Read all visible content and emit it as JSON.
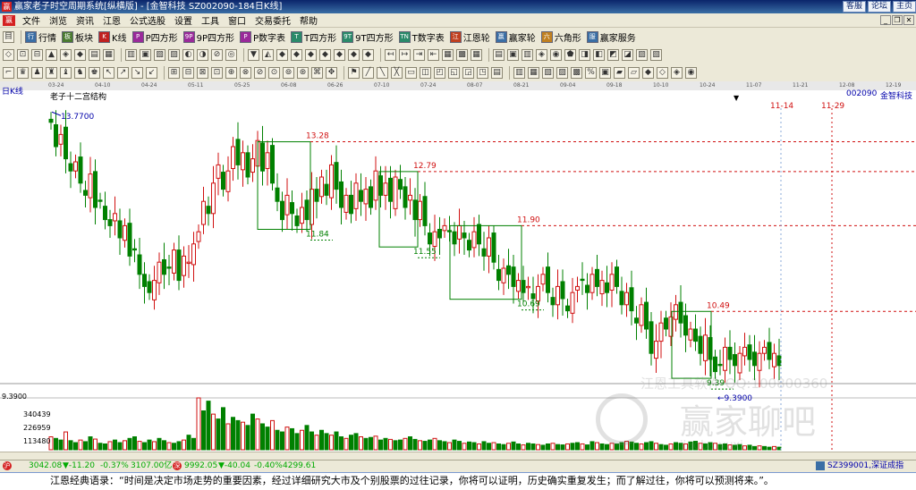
{
  "app": {
    "title": "赢家老子时空周期系统[纵横版] - [金智科技  SZ002090-184日K线]",
    "logo": "赢",
    "title_links": [
      "客服",
      "论坛",
      "主页"
    ]
  },
  "menu": {
    "logo": "赢",
    "items": [
      "文件",
      "浏览",
      "资讯",
      "江恩",
      "公式选股",
      "设置",
      "工具",
      "窗口",
      "交易委托",
      "帮助"
    ]
  },
  "toolbar1": [
    {
      "icon": "行",
      "label": "行情",
      "color": "#3a6ea5"
    },
    {
      "icon": "板",
      "label": "板块",
      "color": "#4a7a30"
    },
    {
      "icon": "K",
      "label": "K线",
      "color": "#c02020"
    },
    {
      "icon": "P",
      "label": "P四方形",
      "color": "#9a2a9a"
    },
    {
      "icon": "9P",
      "label": "9P四方形",
      "color": "#9a2a9a"
    },
    {
      "icon": "P",
      "label": "P数字表",
      "color": "#9a2a9a"
    },
    {
      "icon": "T",
      "label": "T四方形",
      "color": "#2a8a6a"
    },
    {
      "icon": "9T",
      "label": "9T四方形",
      "color": "#2a8a6a"
    },
    {
      "icon": "TN",
      "label": "T数字表",
      "color": "#2a8a6a"
    },
    {
      "icon": "江",
      "label": "江恩轮",
      "color": "#c04020"
    },
    {
      "icon": "赢",
      "label": "赢家轮",
      "color": "#3a6ea5"
    },
    {
      "icon": "六",
      "label": "六角形",
      "color": "#c08020"
    },
    {
      "icon": "服",
      "label": "赢家服务",
      "color": "#3a6ea5"
    }
  ],
  "toolbar2_icons": [
    "◇",
    "⊡",
    "⊟",
    "▲",
    "◈",
    "◆",
    "▤",
    "▦",
    "▥",
    "▣",
    "▧",
    "▨",
    "◐",
    "◑",
    "⊘",
    "◎",
    "▼",
    "◭",
    "◆",
    "◆",
    "◆",
    "◆",
    "◆",
    "◆",
    "◆",
    "↤",
    "↦",
    "⇥",
    "⇤",
    "▦",
    "▩",
    "▦",
    "▤",
    "▣",
    "▥",
    "◈",
    "◉",
    "⬟",
    "◨",
    "◧",
    "◩",
    "◪",
    "▨",
    "▧"
  ],
  "toolbar3_icons": [
    "⌐",
    "♛",
    "♟",
    "♜",
    "♝",
    "♞",
    "♚",
    "↖",
    "↗",
    "↘",
    "↙",
    "⊞",
    "⊟",
    "⊠",
    "⊡",
    "⊕",
    "⊗",
    "⊘",
    "⊙",
    "⊚",
    "⊛",
    "⌘",
    "✥",
    "⚑",
    "╱",
    "╲",
    "╳",
    "▭",
    "◫",
    "◰",
    "◱",
    "◲",
    "◳",
    "▤",
    "▥",
    "▦",
    "▧",
    "▨",
    "▩",
    "%",
    "▣",
    "▰",
    "▱",
    "◆",
    "◇",
    "◈",
    "◉"
  ],
  "date_axis": [
    "03-24",
    "04-10",
    "04-24",
    "05-11",
    "05-25",
    "06-08",
    "06-26",
    "07-10",
    "07-24",
    "08-07",
    "08-21",
    "09-04",
    "09-18",
    "10-10",
    "10-24",
    "11-07",
    "11-21",
    "12-08",
    "12-19"
  ],
  "chart_header": {
    "period": "日K线",
    "indicator": "老子十二宫结构",
    "symbol": "002090",
    "name": "金智科技",
    "marker": "▼"
  },
  "volume_axis": [
    "9.3900",
    "340439",
    "226959",
    "113480"
  ],
  "chart_data": {
    "type": "candlestick",
    "start_price": 13.77,
    "ylim": [
      9.2,
      13.95
    ],
    "high_marker": 13.77,
    "low_marker": 9.39,
    "low_marker_label": "9.3900",
    "box_levels": [
      {
        "high": 13.28,
        "low": 11.84,
        "high_label": "13.28",
        "low_label": "11.84"
      },
      {
        "high": 12.79,
        "low": 11.55,
        "high_label": "12.79",
        "low_label": "11.55"
      },
      {
        "high": 11.9,
        "low": 10.69,
        "high_label": "11.90",
        "low_label": "10.69"
      },
      {
        "high": 10.49,
        "low": 9.39,
        "high_label": "10.49",
        "low_label": "9.39"
      }
    ],
    "future_dates": [
      "11-14",
      "11-29"
    ],
    "high_label": "13.7700",
    "closes": [
      13.6,
      13.2,
      13.4,
      13.0,
      12.8,
      12.95,
      12.6,
      12.4,
      12.75,
      12.2,
      12.3,
      12.0,
      11.9,
      12.1,
      11.7,
      11.9,
      11.4,
      11.5,
      11.1,
      10.9,
      10.8,
      11.0,
      11.3,
      11.1,
      11.2,
      11.5,
      11.0,
      11.4,
      11.3,
      11.6,
      11.8,
      12.3,
      12.1,
      12.6,
      12.9,
      12.5,
      12.8,
      13.2,
      12.9,
      13.1,
      12.7,
      13.0,
      13.3,
      12.8,
      13.1,
      12.6,
      12.3,
      12.0,
      12.4,
      12.1,
      11.9,
      12.2,
      12.0,
      12.5,
      12.3,
      12.7,
      12.4,
      12.9,
      12.5,
      12.2,
      12.4,
      12.1,
      12.6,
      12.3,
      12.5,
      12.2,
      12.8,
      12.4,
      12.6,
      12.3,
      12.7,
      12.5,
      12.2,
      12.4,
      12.0,
      12.3,
      11.9,
      11.6,
      11.8,
      11.7,
      11.9,
      11.8,
      11.6,
      11.9,
      11.7,
      11.5,
      11.8,
      11.6,
      11.4,
      11.7,
      11.3,
      11.0,
      11.2,
      11.1,
      10.9,
      11.0,
      10.8,
      10.9,
      10.7,
      10.9,
      11.1,
      10.8,
      10.6,
      10.9,
      10.7,
      10.5,
      10.8,
      10.9,
      11.0,
      10.8,
      11.1,
      10.9,
      11.0,
      10.8,
      11.1,
      10.9,
      10.6,
      10.8,
      10.5,
      10.3,
      10.6,
      10.2,
      9.8,
      10.0,
      10.3,
      10.2,
      10.4,
      10.6,
      10.3,
      10.1,
      10.2,
      10.0,
      9.8,
      10.1,
      9.7,
      9.5,
      9.6,
      9.9,
      9.7,
      9.6,
      9.8,
      9.9,
      9.7,
      9.6,
      9.8,
      9.9,
      9.7,
      9.8,
      9.6
    ],
    "volumes": [
      40,
      35,
      30,
      55,
      28,
      22,
      30,
      25,
      40,
      33,
      20,
      18,
      25,
      30,
      22,
      28,
      35,
      40,
      26,
      22,
      30,
      25,
      35,
      28,
      22,
      20,
      25,
      30,
      45,
      35,
      160,
      120,
      150,
      110,
      95,
      130,
      80,
      100,
      90,
      85,
      75,
      110,
      95,
      80,
      70,
      90,
      60,
      55,
      70,
      65,
      50,
      60,
      75,
      55,
      45,
      60,
      50,
      45,
      55,
      40,
      35,
      45,
      50,
      40,
      35,
      38,
      42,
      30,
      35,
      32,
      28,
      30,
      35,
      40,
      32,
      28,
      26,
      30,
      35,
      28,
      25,
      22,
      30,
      26,
      20,
      24,
      22,
      18,
      25,
      20,
      22,
      18,
      16,
      20,
      24,
      18,
      15,
      20,
      18,
      16,
      14,
      18,
      20,
      16,
      15,
      18,
      20,
      22,
      18,
      15,
      25,
      22,
      18,
      16,
      20,
      18,
      22,
      26,
      24,
      20,
      18,
      22,
      25,
      20,
      16,
      14,
      18,
      22,
      20,
      18,
      24,
      26,
      20,
      18,
      22,
      20,
      16,
      18,
      15,
      14,
      16,
      12,
      14,
      10,
      12,
      10,
      8,
      10,
      8
    ]
  },
  "watermark": {
    "line1": "江恩工具软件  QQ:100800360",
    "brand": "赢家聊吧",
    "site": "jiaoba.yuxi..."
  },
  "status": {
    "sh_index": "3042.08",
    "sh_change": "▼-11.20",
    "sh_pct": "-0.37%",
    "sh_vol": "3107.00亿",
    "sz_index": "9992.05",
    "sz_change": "▼-40.04",
    "sz_pct": "-0.40%",
    "sz_vol": "4299.61",
    "right": "SZ399001,深证成指"
  },
  "quote": "江恩经典语录：“时间是决定市场走势的重要因素，经过详细研究大市及个别股票的过往记录，你将可以证明，历史确实重复发生；而了解过往，你将可以预测将来。”。"
}
